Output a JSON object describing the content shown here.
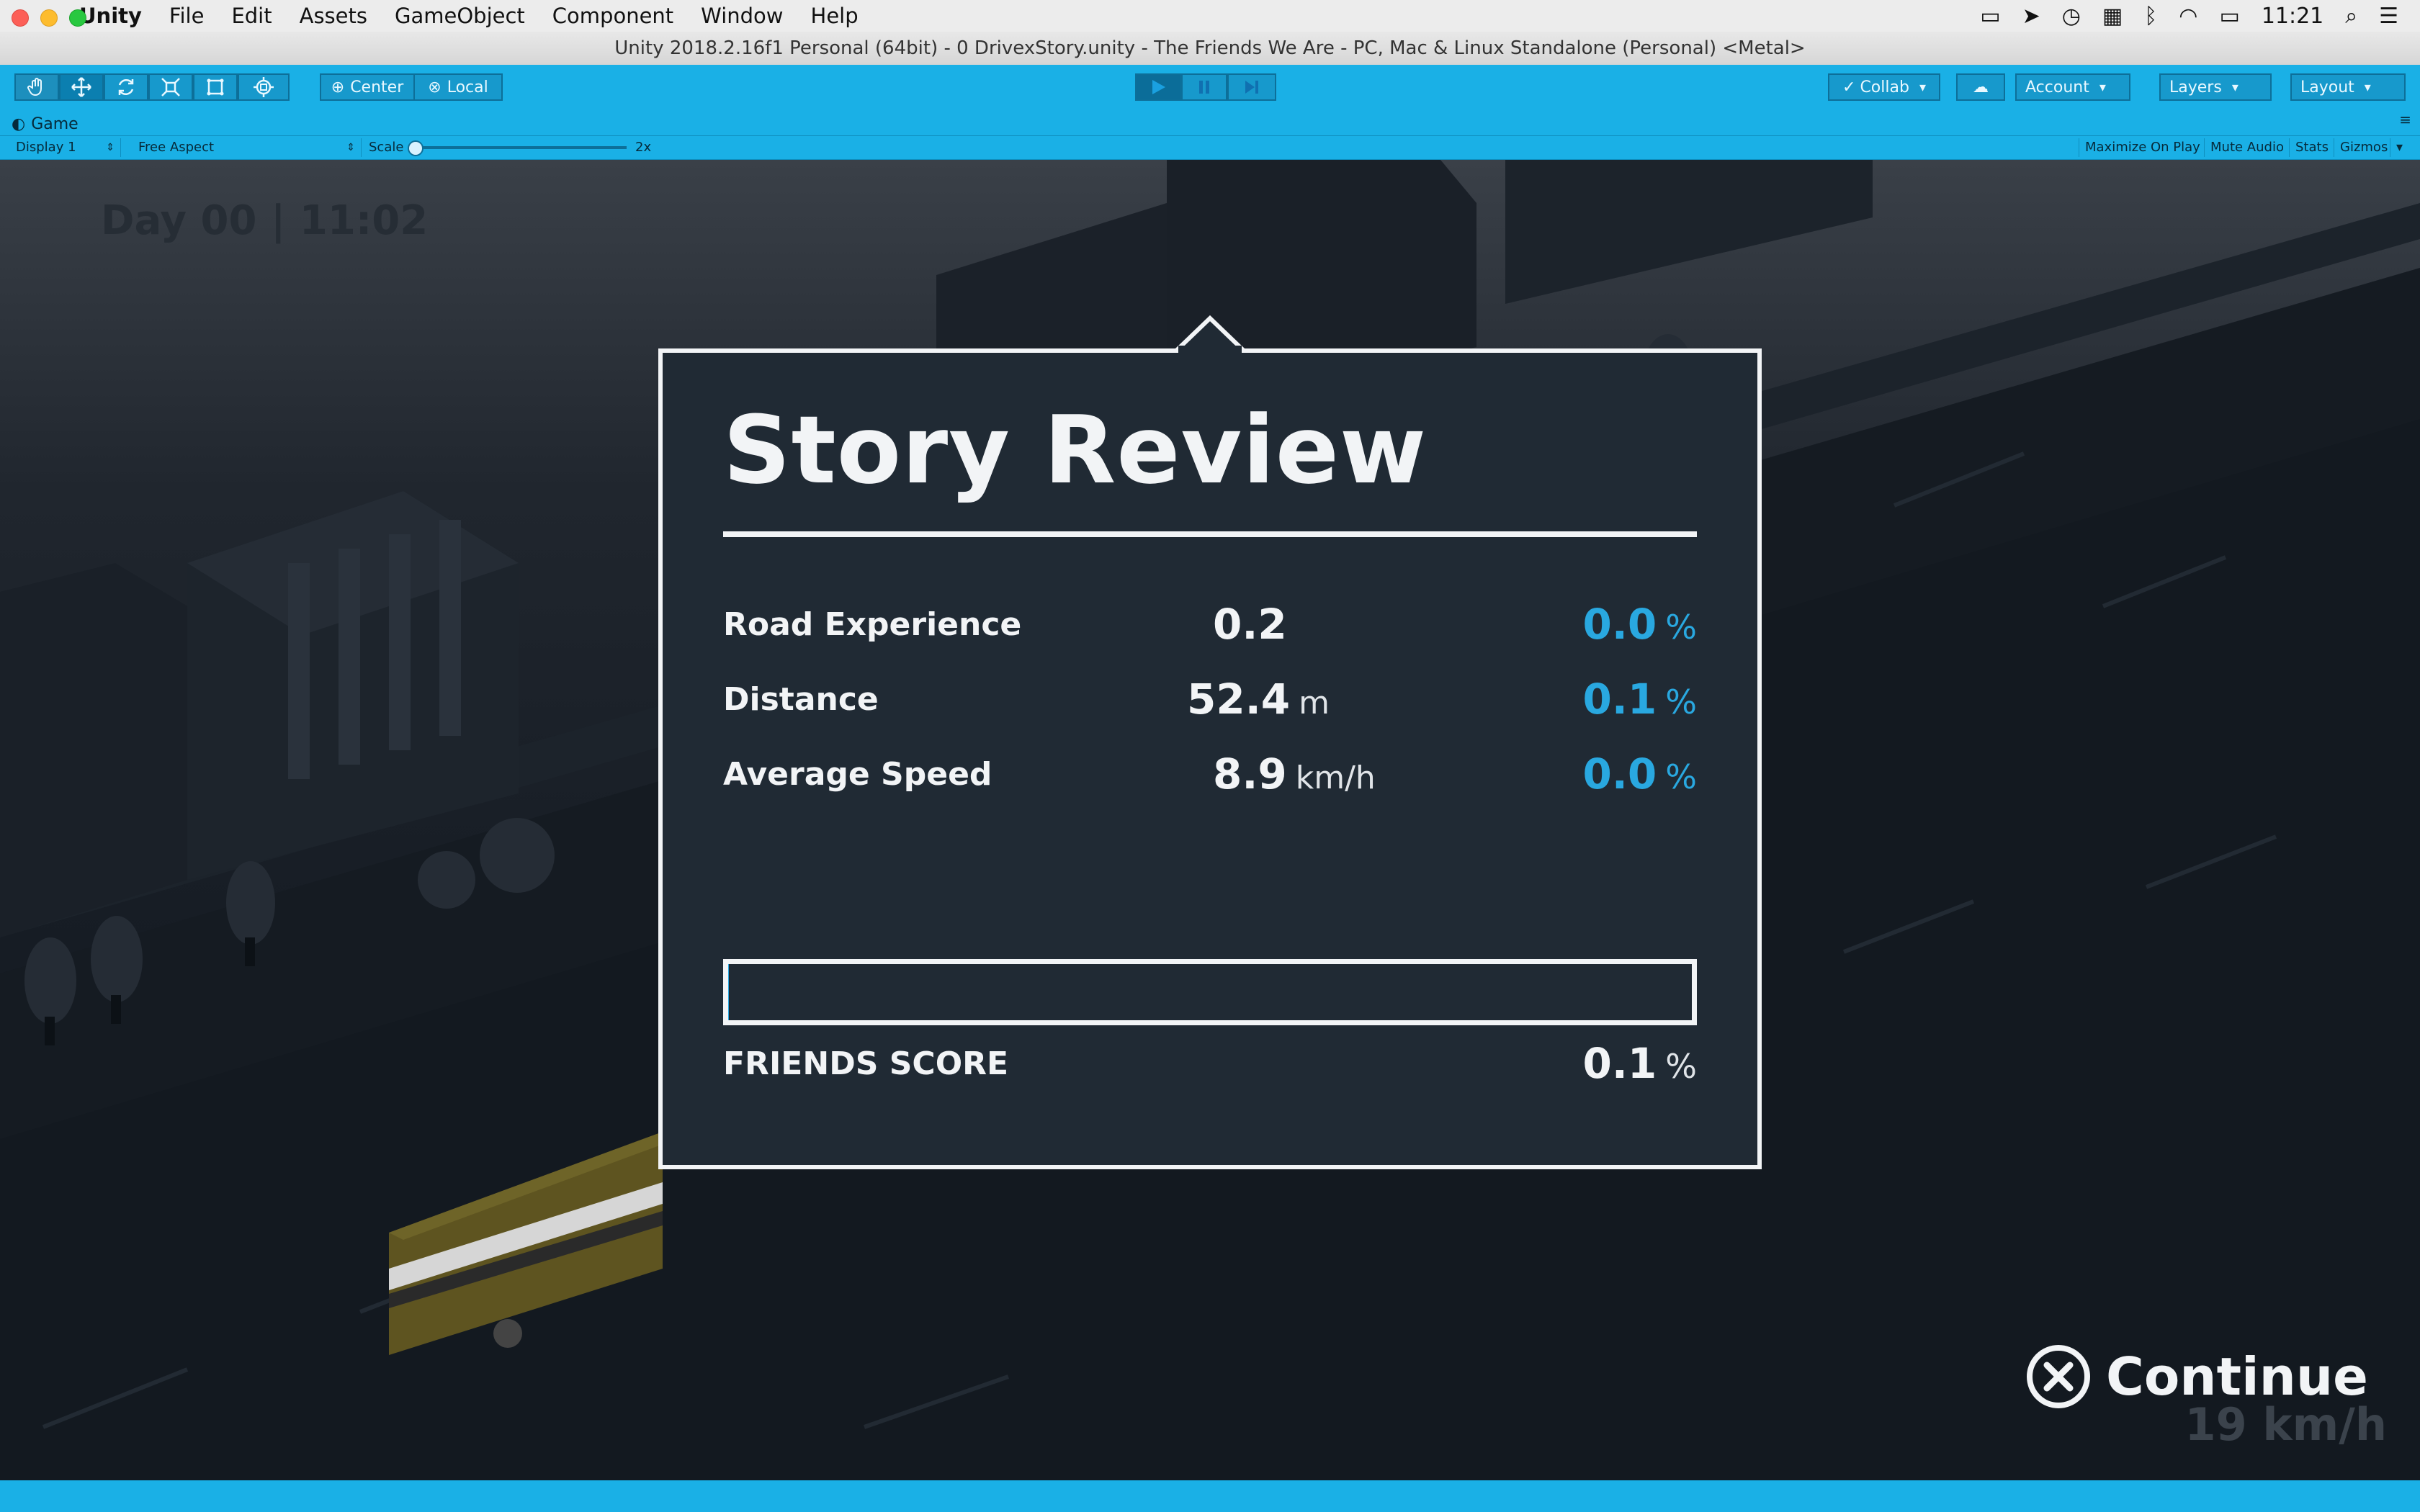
{
  "menubar": {
    "app_name": "Unity",
    "items": [
      "File",
      "Edit",
      "Assets",
      "GameObject",
      "Component",
      "Window",
      "Help"
    ],
    "clock": "11:21"
  },
  "window": {
    "title": "Unity 2018.2.16f1 Personal (64bit) - 0 DrivexStory.unity - The Friends We Are - PC, Mac & Linux Standalone (Personal) <Metal>"
  },
  "toolbar": {
    "tools": [
      "hand-tool-icon",
      "move-tool-icon",
      "rotate-tool-icon",
      "scale-tool-icon",
      "rect-tool-icon",
      "transform-tool-icon"
    ],
    "pivot_label": "Center",
    "space_label": "Local",
    "collab_label": "Collab",
    "account_label": "Account",
    "layers_label": "Layers",
    "layout_label": "Layout"
  },
  "game_view": {
    "tab_label": "Game",
    "display_label": "Display 1",
    "aspect_label": "Free Aspect",
    "scale_label": "Scale",
    "scale_value": "2x",
    "toggles": [
      "Maximize On Play",
      "Mute Audio",
      "Stats",
      "Gizmos"
    ]
  },
  "hud": {
    "day": "Day 00 | 11:02",
    "speed": "19 km/h",
    "continue_label": "Continue"
  },
  "review": {
    "title": "Story Review",
    "rows": [
      {
        "label": "Road Experience",
        "value": "0.2",
        "unit": "",
        "percent": "0.0",
        "percent_sign": "%"
      },
      {
        "label": "Distance",
        "value": "52.4",
        "unit": "m",
        "percent": "0.1",
        "percent_sign": "%"
      },
      {
        "label": "Average Speed",
        "value": "8.9",
        "unit": "km/h",
        "percent": "0.0",
        "percent_sign": "%"
      }
    ],
    "friends_score_label": "FRIENDS SCORE",
    "friends_score_value": "0.1",
    "friends_score_sign": "%",
    "friends_score_fraction": 0.001
  },
  "colors": {
    "unity_accent": "#1ab0e6",
    "panel_bg": "#202a34",
    "percent_blue": "#29a8e0",
    "panel_text": "#f2f4f6"
  }
}
